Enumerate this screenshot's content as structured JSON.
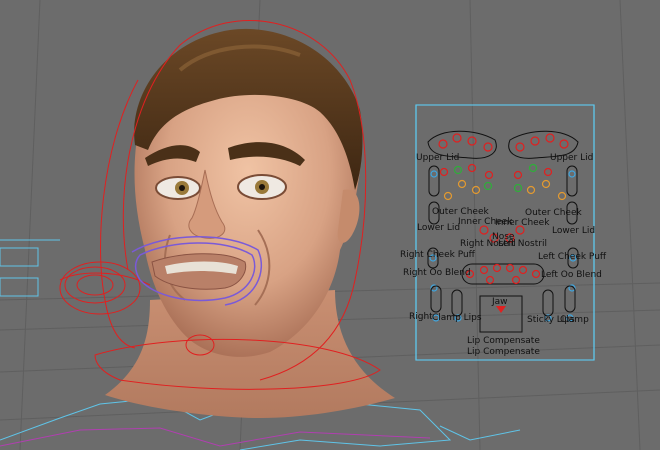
{
  "viewport": {
    "background": "#6c6c6c",
    "grid_color": "#5e5e5e"
  },
  "colors": {
    "rig_curve": "#e02020",
    "picker_border": "#5fc4e8",
    "lip_curve": "#7a5ad8",
    "floor_curve": "#b03fb0",
    "control_blue": "#3ea6e0",
    "control_orange": "#e39a30",
    "control_green": "#2fae3a",
    "skin": "#d39e80",
    "hair": "#5a3a1c"
  },
  "face_picker": {
    "labels": {
      "upper_lid_r": "Upper Lid",
      "upper_lid_l": "Upper Lid",
      "outer_cheek_r": "Outer Cheek",
      "outer_cheek_l": "Outer Cheek",
      "inner_cheek_r": "Inner Cheek",
      "inner_cheek_l": "Inner Cheek",
      "lower_lid_r": "Lower Lid",
      "lower_lid_l": "Lower Lid",
      "nose": "Nose",
      "right_nostril": "Right Nostril",
      "left_nostril": "Left Nostril",
      "right_cheek_puff": "Right Cheek Puff",
      "left_cheek_puff": "Left Cheek Puff",
      "right_oo_blend": "Right Oo Blend",
      "left_oo_blend": "Left Oo Blend",
      "jaw": "Jaw",
      "right_sticky": "Right",
      "clamp_lips": "Clamp Lips",
      "sticky_lips": "Sticky Lips",
      "clamp": "Clamp",
      "lip_compensate_1": "Lip Compensate",
      "lip_compensate_2": "Lip Compensate"
    }
  }
}
